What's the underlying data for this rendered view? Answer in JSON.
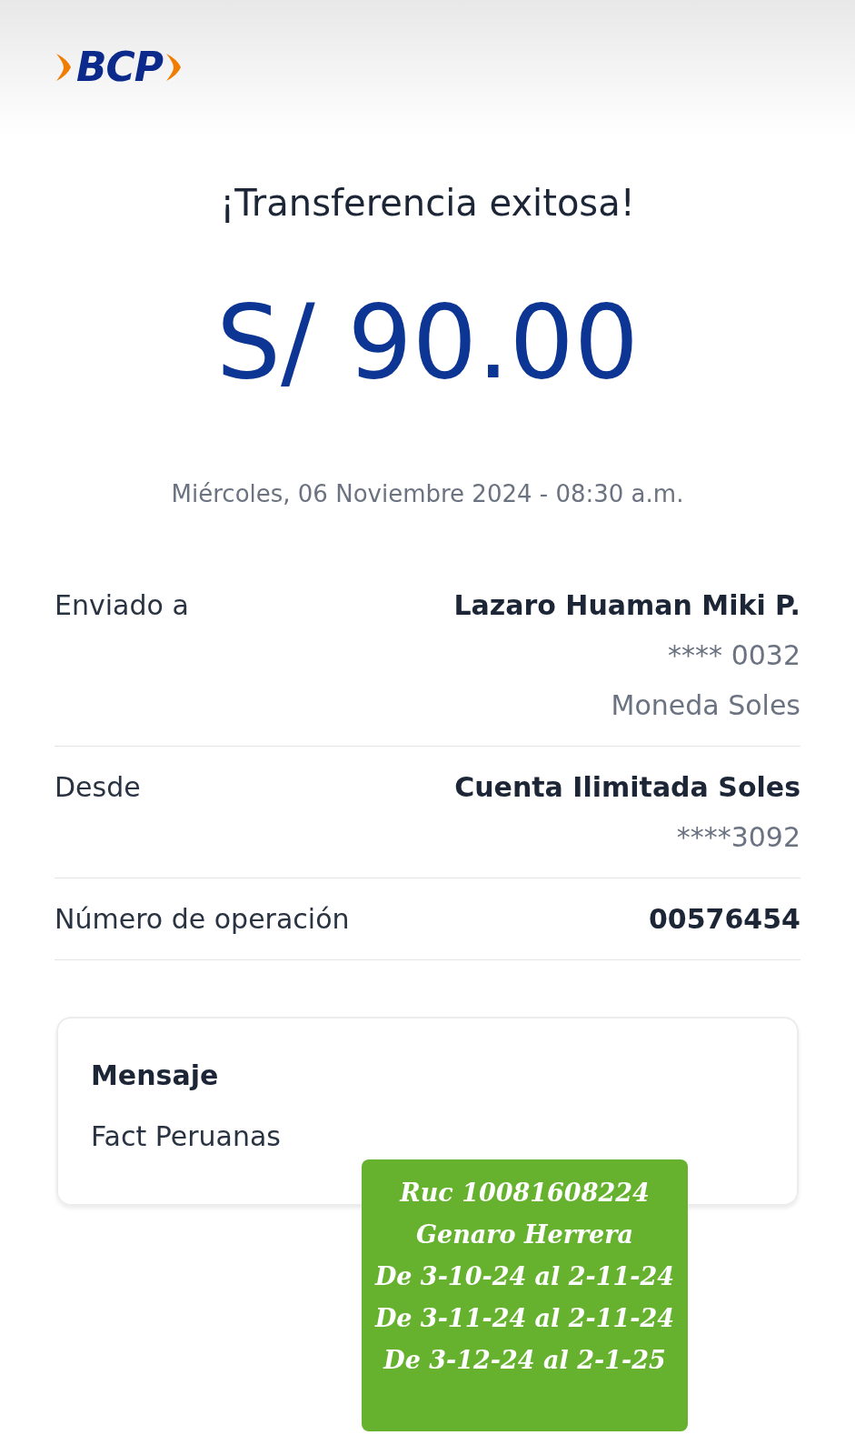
{
  "logo": {
    "text": "BCP"
  },
  "title": "¡Transferencia exitosa!",
  "amount": "S/ 90.00",
  "datetime": "Miércoles, 06 Noviembre 2024 - 08:30 a.m.",
  "details": [
    {
      "label": "Enviado a",
      "values": [
        {
          "kind": "strong",
          "text": "Lazaro Huaman Miki P."
        },
        {
          "kind": "plain",
          "text": "**** 0032"
        },
        {
          "kind": "plain",
          "text": "Moneda Soles"
        }
      ]
    },
    {
      "label": "Desde",
      "values": [
        {
          "kind": "strong",
          "text": "Cuenta Ilimitada Soles"
        },
        {
          "kind": "plain",
          "text": "****3092"
        }
      ]
    },
    {
      "label": "Número de operación",
      "values": [
        {
          "kind": "strong",
          "text": "00576454"
        }
      ]
    }
  ],
  "message": {
    "title": "Mensaje",
    "text": "Fact Peruanas"
  },
  "sticky_note": {
    "lines": [
      "Ruc 10081608224",
      "Genaro Herrera",
      "De 3-10-24 al 2-11-24",
      "De 3-11-24 al 2-11-24",
      "De 3-12-24 al 2-1-25"
    ]
  }
}
